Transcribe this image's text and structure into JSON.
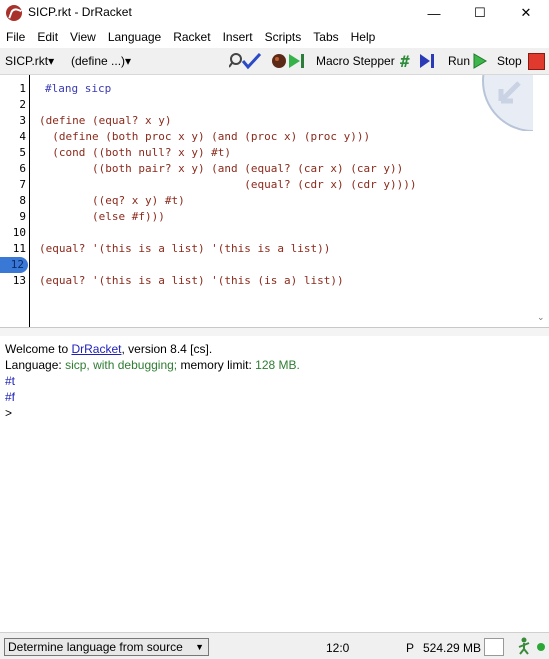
{
  "window": {
    "title": "SICP.rkt - DrRacket",
    "min": "—",
    "max": "☐",
    "close": "✕"
  },
  "menu": [
    "File",
    "Edit",
    "View",
    "Language",
    "Racket",
    "Insert",
    "Scripts",
    "Tabs",
    "Help"
  ],
  "toolbar": {
    "file_label": "SICP.rkt▾",
    "define_label": "(define ...)▾",
    "macro_stepper": "Macro Stepper",
    "run": "Run",
    "stop": "Stop"
  },
  "editor": {
    "line_numbers": [
      "1",
      "2",
      "3",
      "4",
      "5",
      "6",
      "7",
      "8",
      "9",
      "10",
      "11",
      "12",
      "13"
    ],
    "current_line": "12",
    "lines": [
      "#lang sicp",
      "",
      "(define (equal? x y)",
      "  (define (both proc x y) (and (proc x) (proc y)))",
      "  (cond ((both null? x y) #t)",
      "        ((both pair? x y) (and (equal? (car x) (car y))",
      "                               (equal? (cdr x) (cdr y))))",
      "        ((eq? x y) #t)",
      "        (else #f)))",
      "",
      "(equal? '(this is a list) '(this is a list))",
      "",
      "(equal? '(this is a list) '(this (is a) list))"
    ]
  },
  "repl": {
    "welcome_prefix": "Welcome to ",
    "welcome_link": "DrRacket",
    "welcome_suffix": ", version 8.4 [cs].",
    "lang_prefix": "Language: ",
    "lang_value": "sicp, with debugging;",
    "mem_prefix": " memory limit: ",
    "mem_value": "128 MB.",
    "out1": "#t",
    "out2": "#f",
    "prompt": ">"
  },
  "status": {
    "language_select": "Determine language from source",
    "position": "12:0",
    "p": "P",
    "memory": "524.29 MB"
  }
}
